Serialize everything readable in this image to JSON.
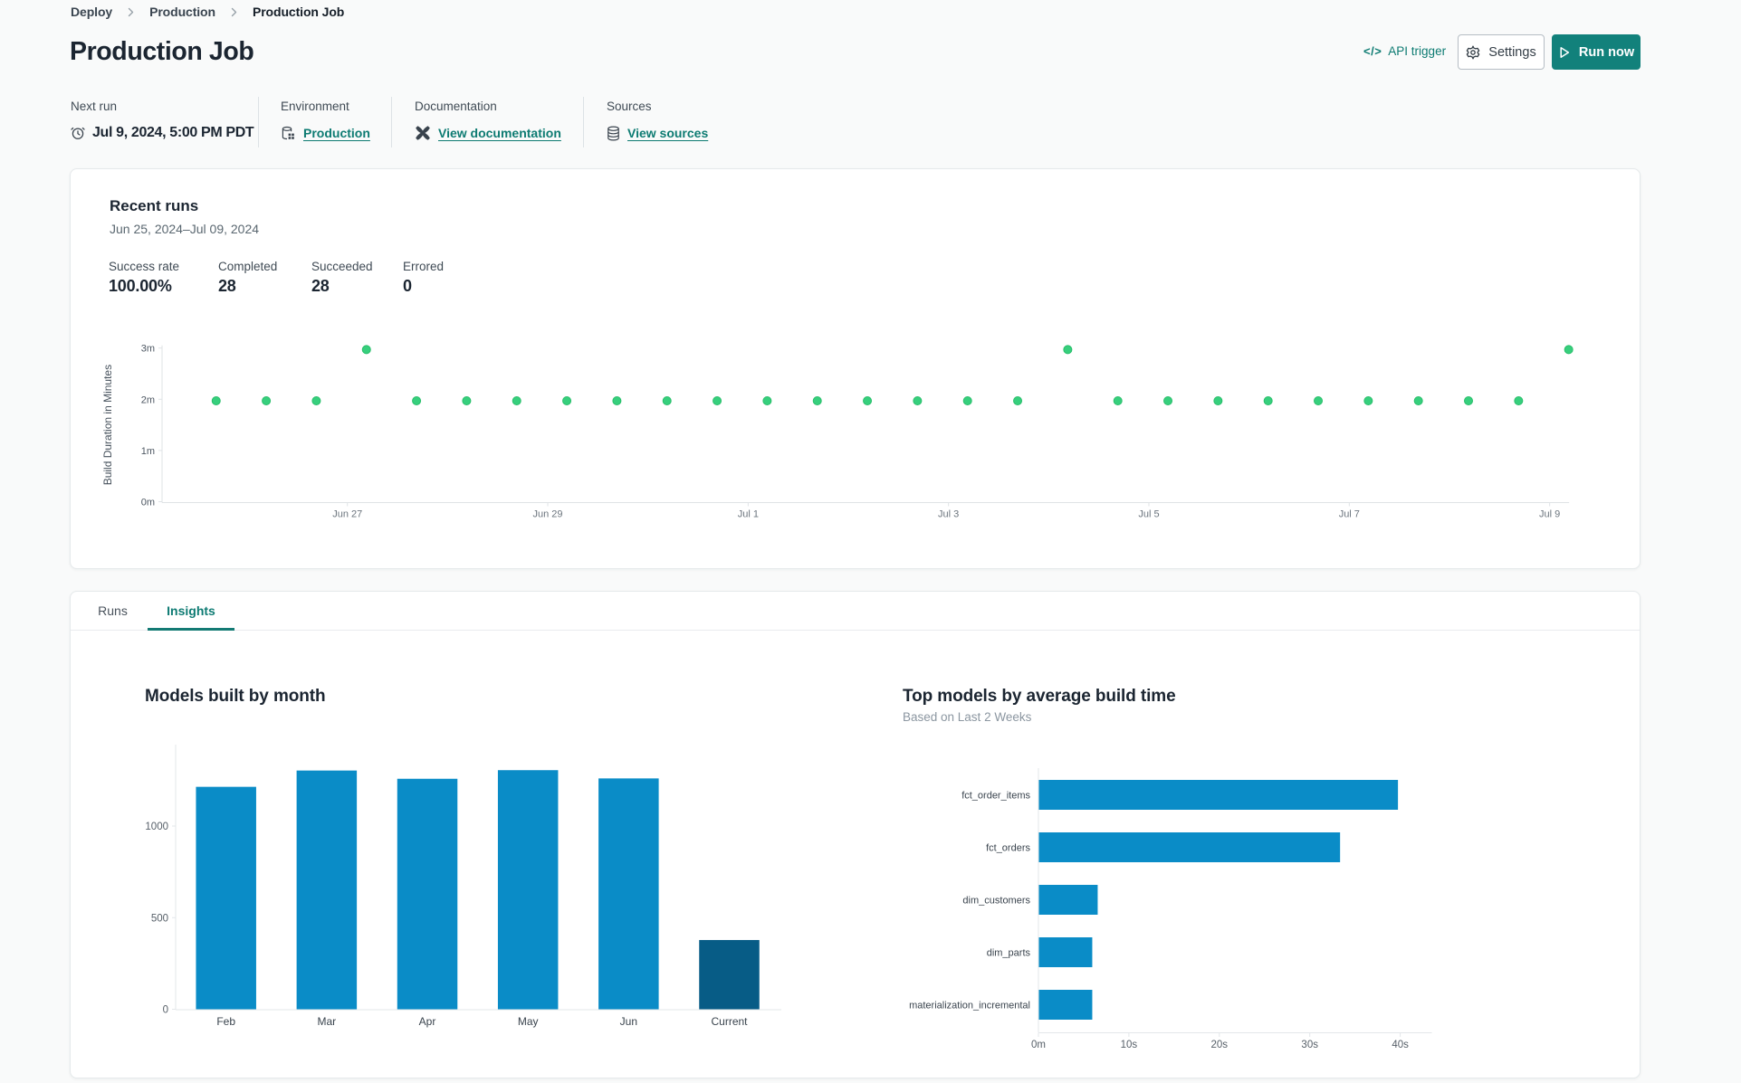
{
  "breadcrumb": {
    "items": [
      "Deploy",
      "Production",
      "Production Job"
    ]
  },
  "header": {
    "title": "Production Job",
    "api_trigger_label": "API trigger",
    "api_trigger_glyph": "</>",
    "settings_label": "Settings",
    "run_now_label": "Run now"
  },
  "meta": {
    "next_run": {
      "label": "Next run",
      "value": "Jul 9, 2024, 5:00 PM PDT"
    },
    "environment": {
      "label": "Environment",
      "link": "Production"
    },
    "documentation": {
      "label": "Documentation",
      "link": "View documentation"
    },
    "sources": {
      "label": "Sources",
      "link": "View sources"
    }
  },
  "recent_runs": {
    "title": "Recent runs",
    "date_range": "Jun 25, 2024–Jul 09, 2024",
    "stats": [
      {
        "label": "Success rate",
        "value": "100.00%"
      },
      {
        "label": "Completed",
        "value": "28"
      },
      {
        "label": "Succeeded",
        "value": "28"
      },
      {
        "label": "Errored",
        "value": "0"
      }
    ]
  },
  "tabs": [
    {
      "label": "Runs",
      "active": false
    },
    {
      "label": "Insights",
      "active": true
    }
  ],
  "colors": {
    "accent_teal": "#0d7b72",
    "run_button": "#12817b",
    "bar_blue": "#0a8cc7",
    "bar_dark_blue": "#075c86",
    "dot_green": "#37cf7d",
    "axis_line": "#dfe3e6"
  },
  "chart_data": [
    {
      "id": "recent-runs-scatter",
      "type": "scatter",
      "ylabel": "Build Duration in Minutes",
      "y_ticks": [
        {
          "value": 0,
          "label": "0m"
        },
        {
          "value": 1,
          "label": "1m"
        },
        {
          "value": 2,
          "label": "2m"
        },
        {
          "value": 3,
          "label": "3m"
        }
      ],
      "x_ticks": [
        {
          "day": 0,
          "label": "Jun 27"
        },
        {
          "day": 2,
          "label": "Jun 29"
        },
        {
          "day": 4,
          "label": "Jul 1"
        },
        {
          "day": 6,
          "label": "Jul 3"
        },
        {
          "day": 8,
          "label": "Jul 5"
        },
        {
          "day": 10,
          "label": "Jul 7"
        },
        {
          "day": 12,
          "label": "Jul 9"
        }
      ],
      "xlim_days": [
        -1.85,
        12.19
      ],
      "ylim_minutes": [
        0,
        3.3
      ],
      "point_color": "#37cf7d",
      "point_edge_color": "#27be69",
      "points": [
        {
          "day": -1.31,
          "minutes": 1.97
        },
        {
          "day": -0.81,
          "minutes": 1.97
        },
        {
          "day": -0.31,
          "minutes": 1.97
        },
        {
          "day": 0.19,
          "minutes": 2.97
        },
        {
          "day": 0.69,
          "minutes": 1.97
        },
        {
          "day": 1.19,
          "minutes": 1.97
        },
        {
          "day": 1.69,
          "minutes": 1.97
        },
        {
          "day": 2.19,
          "minutes": 1.97
        },
        {
          "day": 2.69,
          "minutes": 1.97
        },
        {
          "day": 3.19,
          "minutes": 1.97
        },
        {
          "day": 3.69,
          "minutes": 1.97
        },
        {
          "day": 4.19,
          "minutes": 1.97
        },
        {
          "day": 4.69,
          "minutes": 1.97
        },
        {
          "day": 5.19,
          "minutes": 1.97
        },
        {
          "day": 5.69,
          "minutes": 1.97
        },
        {
          "day": 6.19,
          "minutes": 1.97
        },
        {
          "day": 6.69,
          "minutes": 1.97
        },
        {
          "day": 7.19,
          "minutes": 2.97
        },
        {
          "day": 7.69,
          "minutes": 1.97
        },
        {
          "day": 8.19,
          "minutes": 1.97
        },
        {
          "day": 8.69,
          "minutes": 1.97
        },
        {
          "day": 9.19,
          "minutes": 1.97
        },
        {
          "day": 9.69,
          "minutes": 1.97
        },
        {
          "day": 10.19,
          "minutes": 1.97
        },
        {
          "day": 10.69,
          "minutes": 1.97
        },
        {
          "day": 11.19,
          "minutes": 1.97
        },
        {
          "day": 11.69,
          "minutes": 1.97
        },
        {
          "day": 12.19,
          "minutes": 2.97
        }
      ]
    },
    {
      "id": "models-built-by-month",
      "type": "bar",
      "title": "Models built by month",
      "categories": [
        "Feb",
        "Mar",
        "Apr",
        "May",
        "Jun",
        "Current"
      ],
      "values": [
        1214,
        1303,
        1258,
        1305,
        1260,
        378
      ],
      "y_ticks": [
        0,
        500,
        1000
      ],
      "ylim": [
        0,
        1445
      ],
      "bar_color": "#0a8cc7",
      "current_bar_color": "#075c86"
    },
    {
      "id": "top-models-by-build-time",
      "type": "bar-horizontal",
      "title": "Top models by average build time",
      "subtitle": "Based on Last 2 Weeks",
      "categories": [
        "fct_order_items",
        "fct_orders",
        "dim_customers",
        "dim_parts",
        "materialization_incremental"
      ],
      "values_seconds": [
        39.7,
        33.3,
        6.5,
        5.9,
        5.9
      ],
      "x_ticks": [
        {
          "value": 0,
          "label": "0m"
        },
        {
          "value": 10,
          "label": "10s"
        },
        {
          "value": 20,
          "label": "20s"
        },
        {
          "value": 30,
          "label": "30s"
        },
        {
          "value": 40,
          "label": "40s"
        }
      ],
      "xlim_seconds": [
        0,
        43.5
      ],
      "bar_color": "#0a8cc7"
    }
  ]
}
